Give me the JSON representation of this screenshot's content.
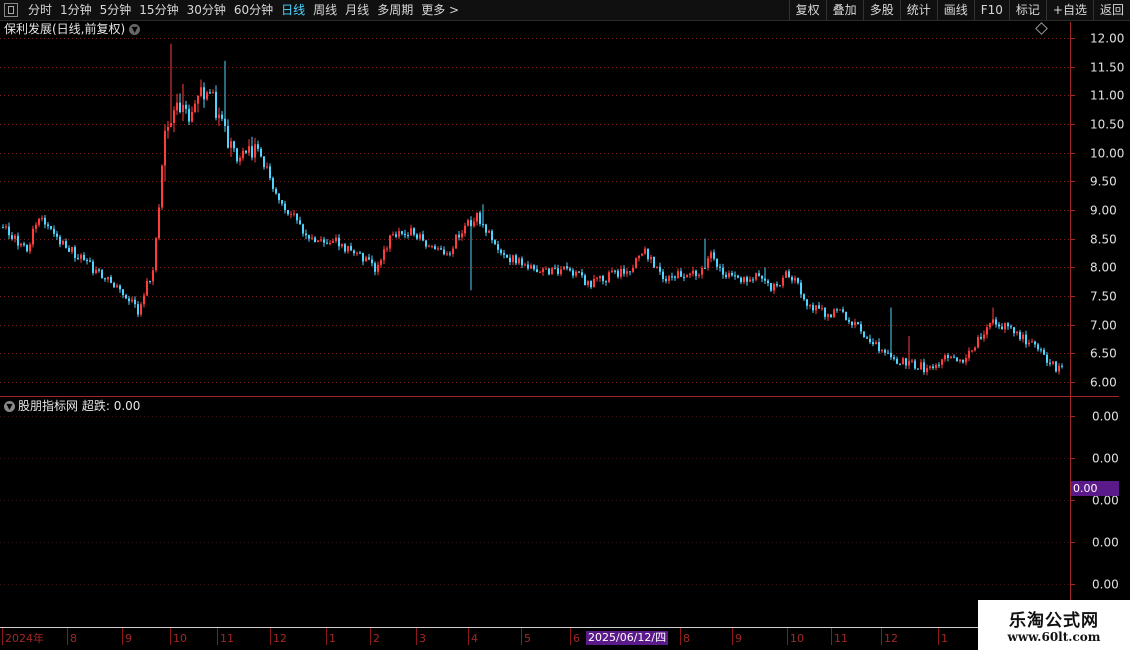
{
  "toolbar": {
    "periods": [
      "分时",
      "1分钟",
      "5分钟",
      "15分钟",
      "30分钟",
      "60分钟",
      "日线",
      "周线",
      "月线",
      "多周期",
      "更多 >"
    ],
    "active_period": "日线",
    "right_buttons": [
      "复权",
      "叠加",
      "多股",
      "统计",
      "画线",
      "F10",
      "标记",
      "+自选",
      "返回"
    ]
  },
  "main_panel": {
    "title": "保利发展(日线,前复权)"
  },
  "sub_panel": {
    "title": "股朋指标网",
    "indicator": "超跌: 0.00",
    "y_labels": [
      "0.00",
      "0.00",
      "0.00",
      "0.00",
      "0.00"
    ],
    "cursor_value": "0.00"
  },
  "x_axis": {
    "labels": [
      "2024年",
      "8",
      "9",
      "10",
      "11",
      "12",
      "1",
      "2",
      "3",
      "4",
      "5",
      "6",
      "2025/06/12/四",
      "8",
      "9",
      "10",
      "11",
      "12",
      "1"
    ],
    "highlight": "2025/06/12/四"
  },
  "watermark": {
    "line1": "乐淘公式网",
    "line2": "www.60lt.com"
  },
  "colors": {
    "up": "#ff3c3c",
    "down": "#4ed4ff",
    "grid": "#7a1e1e",
    "axis": "#a02828",
    "active": "#4ed4ff"
  },
  "chart_data": {
    "type": "candlestick",
    "y_axis_labels": [
      "12.00",
      "11.50",
      "11.00",
      "10.50",
      "10.00",
      "9.50",
      "9.00",
      "8.50",
      "8.00",
      "7.50",
      "7.00",
      "6.50",
      "6.00"
    ],
    "ylim": [
      5.9,
      12.1
    ],
    "anchors": [
      [
        0,
        8.7
      ],
      [
        8,
        8.3
      ],
      [
        12,
        8.9
      ],
      [
        18,
        8.5
      ],
      [
        25,
        8.2
      ],
      [
        32,
        7.9
      ],
      [
        40,
        7.6
      ],
      [
        45,
        7.2
      ],
      [
        50,
        8.0
      ],
      [
        52,
        9.0
      ],
      [
        54,
        10.5
      ],
      [
        58,
        10.8
      ],
      [
        62,
        10.6
      ],
      [
        66,
        11.0
      ],
      [
        70,
        10.9
      ],
      [
        74,
        10.3
      ],
      [
        78,
        9.9
      ],
      [
        84,
        10.1
      ],
      [
        88,
        9.7
      ],
      [
        92,
        9.2
      ],
      [
        98,
        8.8
      ],
      [
        104,
        8.4
      ],
      [
        110,
        8.5
      ],
      [
        118,
        8.2
      ],
      [
        124,
        8.0
      ],
      [
        130,
        8.6
      ],
      [
        136,
        8.6
      ],
      [
        142,
        8.4
      ],
      [
        148,
        8.2
      ],
      [
        152,
        8.6
      ],
      [
        158,
        8.9
      ],
      [
        162,
        8.6
      ],
      [
        166,
        8.2
      ],
      [
        172,
        8.1
      ],
      [
        180,
        7.9
      ],
      [
        188,
        8.0
      ],
      [
        196,
        7.7
      ],
      [
        204,
        7.9
      ],
      [
        210,
        8.0
      ],
      [
        214,
        8.3
      ],
      [
        220,
        7.8
      ],
      [
        226,
        7.9
      ],
      [
        232,
        7.9
      ],
      [
        236,
        8.2
      ],
      [
        240,
        7.9
      ],
      [
        246,
        7.8
      ],
      [
        252,
        7.9
      ],
      [
        256,
        7.6
      ],
      [
        262,
        7.9
      ],
      [
        268,
        7.4
      ],
      [
        274,
        7.2
      ],
      [
        280,
        7.2
      ],
      [
        286,
        6.9
      ],
      [
        292,
        6.6
      ],
      [
        298,
        6.4
      ],
      [
        304,
        6.3
      ],
      [
        310,
        6.2
      ],
      [
        314,
        6.5
      ],
      [
        320,
        6.4
      ],
      [
        326,
        6.8
      ],
      [
        330,
        7.1
      ],
      [
        336,
        6.9
      ],
      [
        342,
        6.7
      ],
      [
        348,
        6.4
      ],
      [
        352,
        6.2
      ]
    ],
    "spikes": [
      [
        54,
        9.5
      ],
      [
        56,
        11.9
      ],
      [
        60,
        11.2
      ],
      [
        74,
        11.6
      ],
      [
        160,
        9.1
      ],
      [
        156,
        7.6
      ],
      [
        234,
        8.5
      ],
      [
        254,
        8.0
      ],
      [
        302,
        6.8
      ],
      [
        330,
        7.3
      ],
      [
        296,
        7.3
      ]
    ],
    "n_bars": 354
  }
}
